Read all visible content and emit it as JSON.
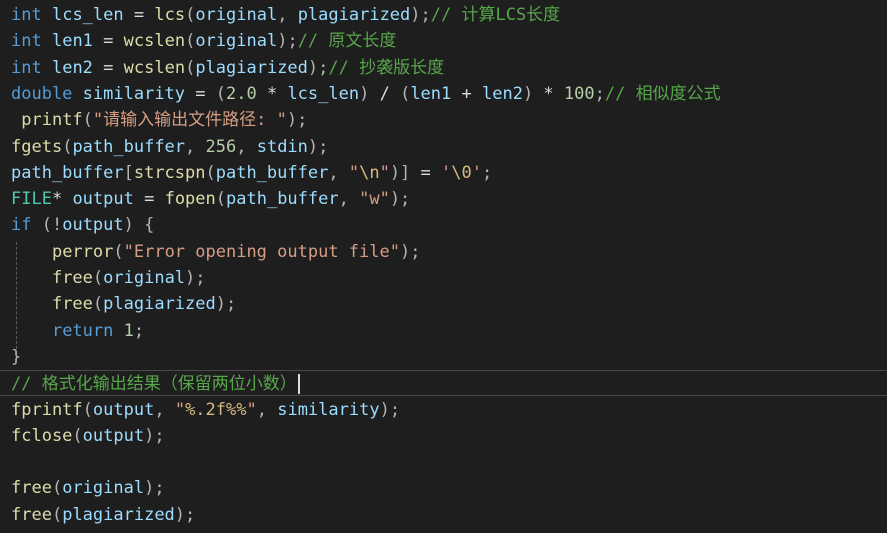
{
  "editor": {
    "lines": [
      {
        "tokens": [
          [
            "keyword",
            "int"
          ],
          [
            "plain",
            " "
          ],
          [
            "var",
            "lcs_len"
          ],
          [
            "plain",
            " = "
          ],
          [
            "func",
            "lcs"
          ],
          [
            "punct",
            "("
          ],
          [
            "var",
            "original"
          ],
          [
            "punct",
            ", "
          ],
          [
            "var",
            "plagiarized"
          ],
          [
            "punct",
            ");"
          ],
          [
            "comment",
            "// 计算LCS长度"
          ]
        ]
      },
      {
        "tokens": [
          [
            "keyword",
            "int"
          ],
          [
            "plain",
            " "
          ],
          [
            "var",
            "len1"
          ],
          [
            "plain",
            " = "
          ],
          [
            "func",
            "wcslen"
          ],
          [
            "punct",
            "("
          ],
          [
            "var",
            "original"
          ],
          [
            "punct",
            ");"
          ],
          [
            "comment",
            "// 原文长度"
          ]
        ]
      },
      {
        "tokens": [
          [
            "keyword",
            "int"
          ],
          [
            "plain",
            " "
          ],
          [
            "var",
            "len2"
          ],
          [
            "plain",
            " = "
          ],
          [
            "func",
            "wcslen"
          ],
          [
            "punct",
            "("
          ],
          [
            "var",
            "plagiarized"
          ],
          [
            "punct",
            ");"
          ],
          [
            "comment",
            "// 抄袭版长度"
          ]
        ]
      },
      {
        "tokens": [
          [
            "keyword",
            "double"
          ],
          [
            "plain",
            " "
          ],
          [
            "var",
            "similarity"
          ],
          [
            "plain",
            " = "
          ],
          [
            "punct",
            "("
          ],
          [
            "number",
            "2.0"
          ],
          [
            "plain",
            " * "
          ],
          [
            "var",
            "lcs_len"
          ],
          [
            "punct",
            ")"
          ],
          [
            "plain",
            " / "
          ],
          [
            "punct",
            "("
          ],
          [
            "var",
            "len1"
          ],
          [
            "plain",
            " + "
          ],
          [
            "var",
            "len2"
          ],
          [
            "punct",
            ")"
          ],
          [
            "plain",
            " * "
          ],
          [
            "number",
            "100"
          ],
          [
            "punct",
            ";"
          ],
          [
            "comment",
            "// 相似度公式"
          ]
        ]
      },
      {
        "tokens": [
          [
            "plain",
            " "
          ],
          [
            "func",
            "printf"
          ],
          [
            "punct",
            "("
          ],
          [
            "string",
            "\"请输入输出文件路径: \""
          ],
          [
            "punct",
            ");"
          ]
        ]
      },
      {
        "tokens": [
          [
            "func",
            "fgets"
          ],
          [
            "punct",
            "("
          ],
          [
            "var",
            "path_buffer"
          ],
          [
            "punct",
            ", "
          ],
          [
            "number",
            "256"
          ],
          [
            "punct",
            ", "
          ],
          [
            "var",
            "stdin"
          ],
          [
            "punct",
            ");"
          ]
        ]
      },
      {
        "tokens": [
          [
            "var",
            "path_buffer"
          ],
          [
            "punct",
            "["
          ],
          [
            "func",
            "strcspn"
          ],
          [
            "punct",
            "("
          ],
          [
            "var",
            "path_buffer"
          ],
          [
            "punct",
            ", "
          ],
          [
            "string",
            "\""
          ],
          [
            "escape",
            "\\n"
          ],
          [
            "string",
            "\""
          ],
          [
            "punct",
            ")]"
          ],
          [
            "plain",
            " = "
          ],
          [
            "string",
            "'"
          ],
          [
            "escape",
            "\\0"
          ],
          [
            "string",
            "'"
          ],
          [
            "punct",
            ";"
          ]
        ]
      },
      {
        "tokens": [
          [
            "type",
            "FILE"
          ],
          [
            "plain",
            "* "
          ],
          [
            "var",
            "output"
          ],
          [
            "plain",
            " = "
          ],
          [
            "func",
            "fopen"
          ],
          [
            "punct",
            "("
          ],
          [
            "var",
            "path_buffer"
          ],
          [
            "punct",
            ", "
          ],
          [
            "string",
            "\"w\""
          ],
          [
            "punct",
            ");"
          ]
        ]
      },
      {
        "tokens": [
          [
            "keyword",
            "if"
          ],
          [
            "plain",
            " "
          ],
          [
            "punct",
            "(!"
          ],
          [
            "var",
            "output"
          ],
          [
            "punct",
            ")"
          ],
          [
            "plain",
            " "
          ],
          [
            "punct",
            "{"
          ]
        ]
      },
      {
        "tokens": [
          [
            "plain",
            "    "
          ],
          [
            "func",
            "perror"
          ],
          [
            "punct",
            "("
          ],
          [
            "string",
            "\"Error opening output file\""
          ],
          [
            "punct",
            ");"
          ]
        ]
      },
      {
        "tokens": [
          [
            "plain",
            "    "
          ],
          [
            "func",
            "free"
          ],
          [
            "punct",
            "("
          ],
          [
            "var",
            "original"
          ],
          [
            "punct",
            ");"
          ]
        ]
      },
      {
        "tokens": [
          [
            "plain",
            "    "
          ],
          [
            "func",
            "free"
          ],
          [
            "punct",
            "("
          ],
          [
            "var",
            "plagiarized"
          ],
          [
            "punct",
            ");"
          ]
        ]
      },
      {
        "tokens": [
          [
            "plain",
            "    "
          ],
          [
            "keyword",
            "return"
          ],
          [
            "plain",
            " "
          ],
          [
            "number",
            "1"
          ],
          [
            "punct",
            ";"
          ]
        ]
      },
      {
        "tokens": [
          [
            "punct",
            "}"
          ]
        ]
      },
      {
        "tokens": [
          [
            "comment",
            "// 格式化输出结果（保留两位小数）"
          ]
        ],
        "current": true
      },
      {
        "tokens": [
          [
            "func",
            "fprintf"
          ],
          [
            "punct",
            "("
          ],
          [
            "var",
            "output"
          ],
          [
            "punct",
            ", "
          ],
          [
            "string",
            "\""
          ],
          [
            "escape",
            "%.2f%%"
          ],
          [
            "string",
            "\""
          ],
          [
            "punct",
            ", "
          ],
          [
            "var",
            "similarity"
          ],
          [
            "punct",
            ");"
          ]
        ]
      },
      {
        "tokens": [
          [
            "func",
            "fclose"
          ],
          [
            "punct",
            "("
          ],
          [
            "var",
            "output"
          ],
          [
            "punct",
            ");"
          ]
        ]
      },
      {
        "tokens": []
      },
      {
        "tokens": [
          [
            "func",
            "free"
          ],
          [
            "punct",
            "("
          ],
          [
            "var",
            "original"
          ],
          [
            "punct",
            ");"
          ]
        ]
      },
      {
        "tokens": [
          [
            "func",
            "free"
          ],
          [
            "punct",
            "("
          ],
          [
            "var",
            "plagiarized"
          ],
          [
            "punct",
            ");"
          ]
        ]
      }
    ]
  },
  "colors": {
    "background": "#1e1e1e",
    "keyword": "#569cd6",
    "type": "#4ec9b0",
    "function": "#dcdcaa",
    "variable": "#9cdcfe",
    "string": "#d69d85",
    "number": "#b5cea8",
    "comment": "#57a64a",
    "current_line_border": "#4a4a4a"
  }
}
